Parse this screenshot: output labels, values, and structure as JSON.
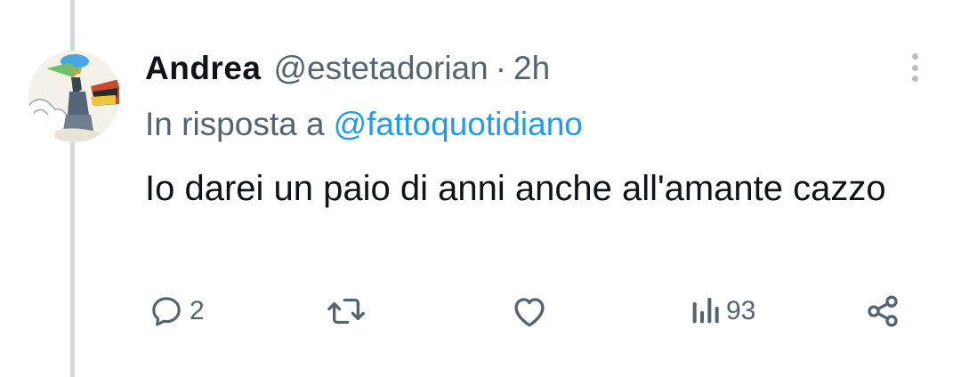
{
  "tweet": {
    "author": {
      "display_name": "Andrea",
      "handle": "@estetadorian",
      "separator": "·",
      "time": "2h",
      "avatar_icon": "avatar-knight-on-horse"
    },
    "reply_to": {
      "prefix": "In risposta a",
      "mention": "@fattoquotidiano"
    },
    "text": "Io darei un paio di anni anche all'amante cazzo",
    "actions": {
      "reply": {
        "icon": "reply-icon",
        "count": "2"
      },
      "retweet": {
        "icon": "retweet-icon"
      },
      "like": {
        "icon": "heart-icon"
      },
      "views": {
        "icon": "views-icon",
        "count": "93"
      },
      "share": {
        "icon": "share-icon"
      }
    }
  },
  "colors": {
    "text_primary": "#0f1419",
    "text_secondary": "#536471",
    "link": "#1d9bf0",
    "thread_line": "#cfd9de"
  }
}
